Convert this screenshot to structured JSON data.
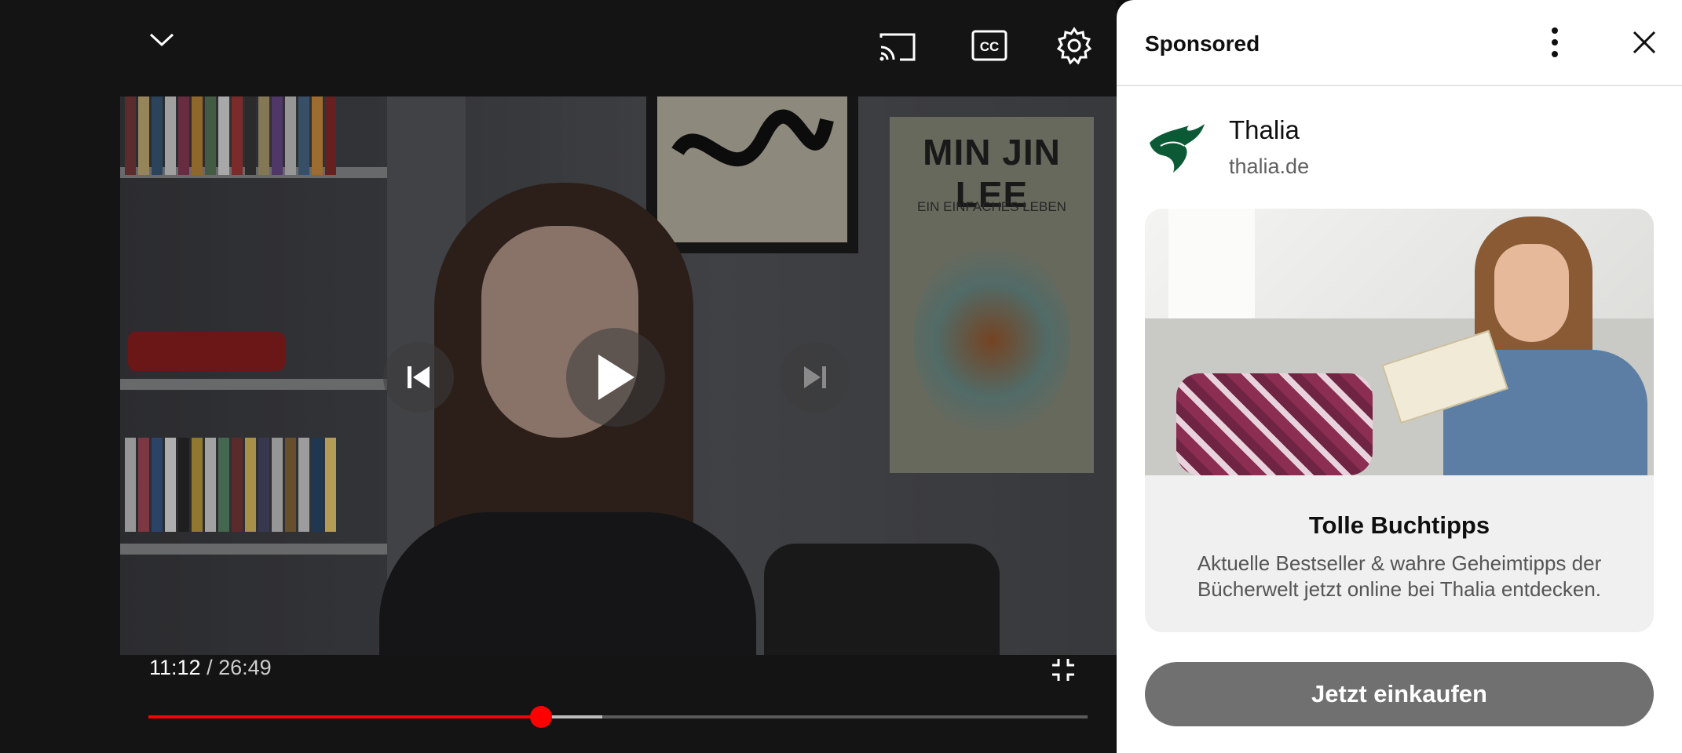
{
  "player": {
    "time_current": "11:12",
    "time_separator": " / ",
    "time_duration": "26:49",
    "progress_played": 0.4177,
    "progress_buffered": 0.4835,
    "icons": [
      "chevron-down-icon",
      "cast-icon",
      "closed-captions-icon",
      "settings-gear-icon",
      "previous-icon",
      "play-icon",
      "next-icon",
      "exit-fullscreen-icon"
    ]
  },
  "video_scene": {
    "poster_title": "MIN JIN LEE",
    "poster_subtitle": "EIN EINFACHES LEBEN"
  },
  "ad_panel": {
    "header_label": "Sponsored",
    "advertiser_name": "Thalia",
    "advertiser_domain": "thalia.de",
    "card_title": "Tolle Buchtipps",
    "card_description": "Aktuelle Bestseller & wahre Geheimtipps der Bücherwelt jetzt online bei Thalia entdecken.",
    "cta_label": "Jetzt einkaufen",
    "logo_color": "#0b5a35"
  },
  "colors": {
    "progress_played": "#ff0000",
    "cta_background": "#707070"
  }
}
